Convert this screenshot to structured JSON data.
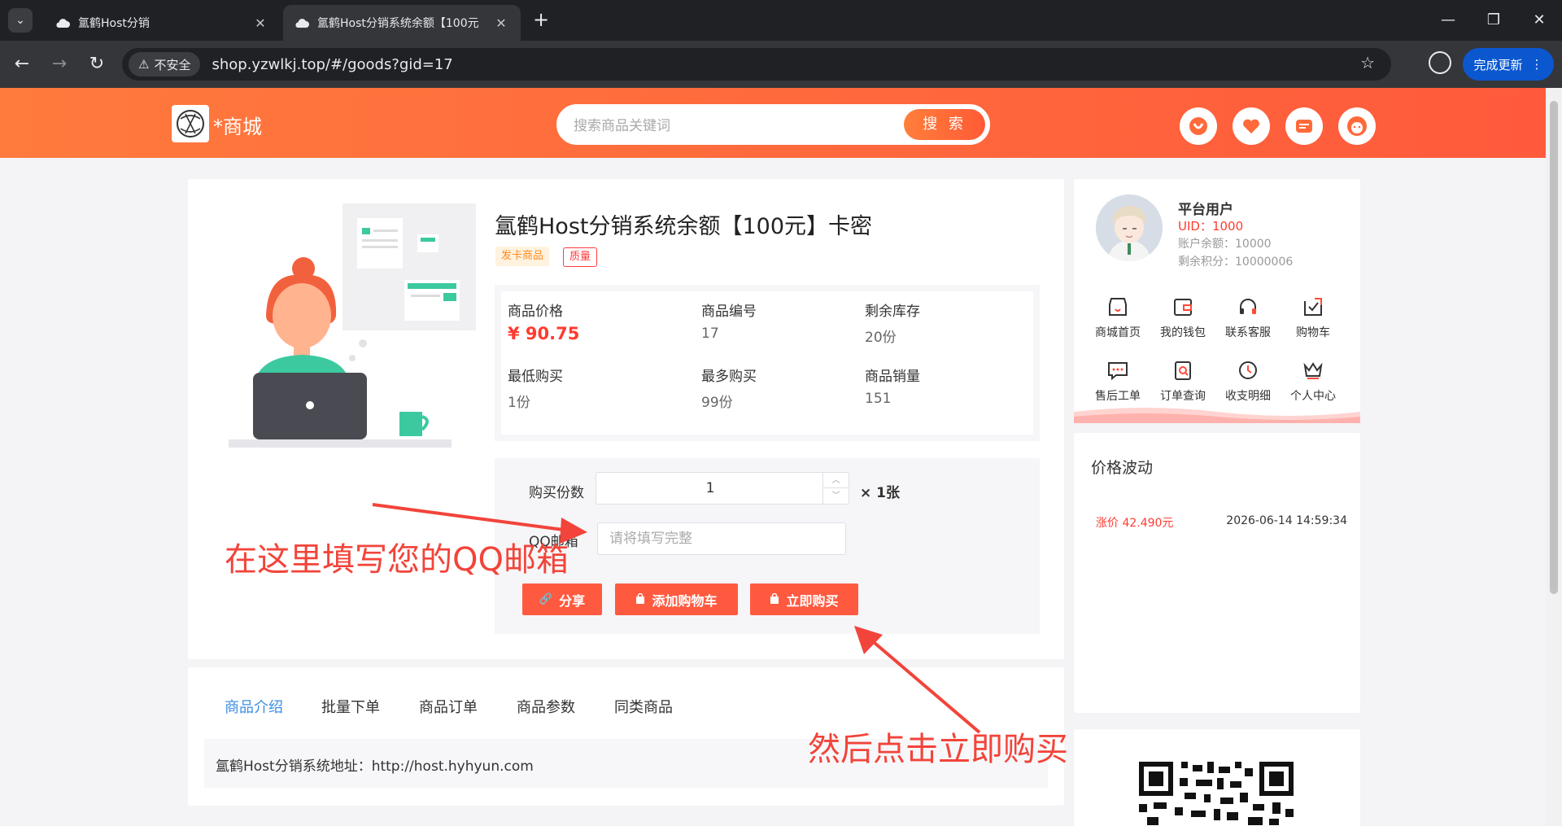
{
  "browser": {
    "tabs": [
      {
        "title": "氲鹤Host分销",
        "active": false
      },
      {
        "title": "氲鹤Host分销系统余额【100元",
        "active": true
      }
    ],
    "security_label": "不安全",
    "url": "shop.yzwlkj.top/#/goods?gid=17",
    "update_label": "完成更新"
  },
  "header": {
    "logo_text": "*商城",
    "search_placeholder": "搜索商品关键词",
    "search_button": "搜 索",
    "icons": [
      "coupon-icon",
      "favorite-icon",
      "message-icon",
      "service-icon"
    ],
    "accent_color": "#ff6a3a"
  },
  "product": {
    "title": "氲鹤Host分销系统余额【100元】卡密",
    "tags": [
      "发卡商品",
      "质量"
    ],
    "info": [
      {
        "label": "商品价格",
        "value": "¥  90.75"
      },
      {
        "label": "商品编号",
        "value": "17"
      },
      {
        "label": "剩余库存",
        "value": "20份"
      },
      {
        "label": "最低购买",
        "value": "1份"
      },
      {
        "label": "最多购买",
        "value": "99份"
      },
      {
        "label": "商品销量",
        "value": "151"
      }
    ],
    "quantity_label": "购买份数",
    "quantity_value": "1",
    "quantity_unit": "× 1张",
    "qq_label": "QQ邮箱",
    "qq_placeholder": "请将填写完整",
    "buttons": {
      "share": "分享",
      "add_cart": "添加购物车",
      "buy_now": "立即购买"
    }
  },
  "tabs": {
    "items": [
      "商品介绍",
      "批量下单",
      "商品订单",
      "商品参数",
      "同类商品"
    ],
    "description": "氲鹤Host分销系统地址：http://host.hyhyun.com"
  },
  "user": {
    "name": "平台用户",
    "uid": "UID：1000",
    "balance": "账户余额：10000",
    "points": "剩余积分：10000006",
    "menu": [
      "商城首页",
      "我的钱包",
      "联系客服",
      "购物车",
      "售后工单",
      "订单查询",
      "收支明细",
      "个人中心"
    ]
  },
  "price_fluctuation": {
    "title": "价格波动",
    "change": "涨价 42.490元",
    "time": "2026-06-14 14:59:34"
  },
  "annotations": {
    "fill_hint": "在这里填写您的QQ邮箱",
    "click_hint": "然后点击立即购买",
    "color": "#f2443a"
  }
}
